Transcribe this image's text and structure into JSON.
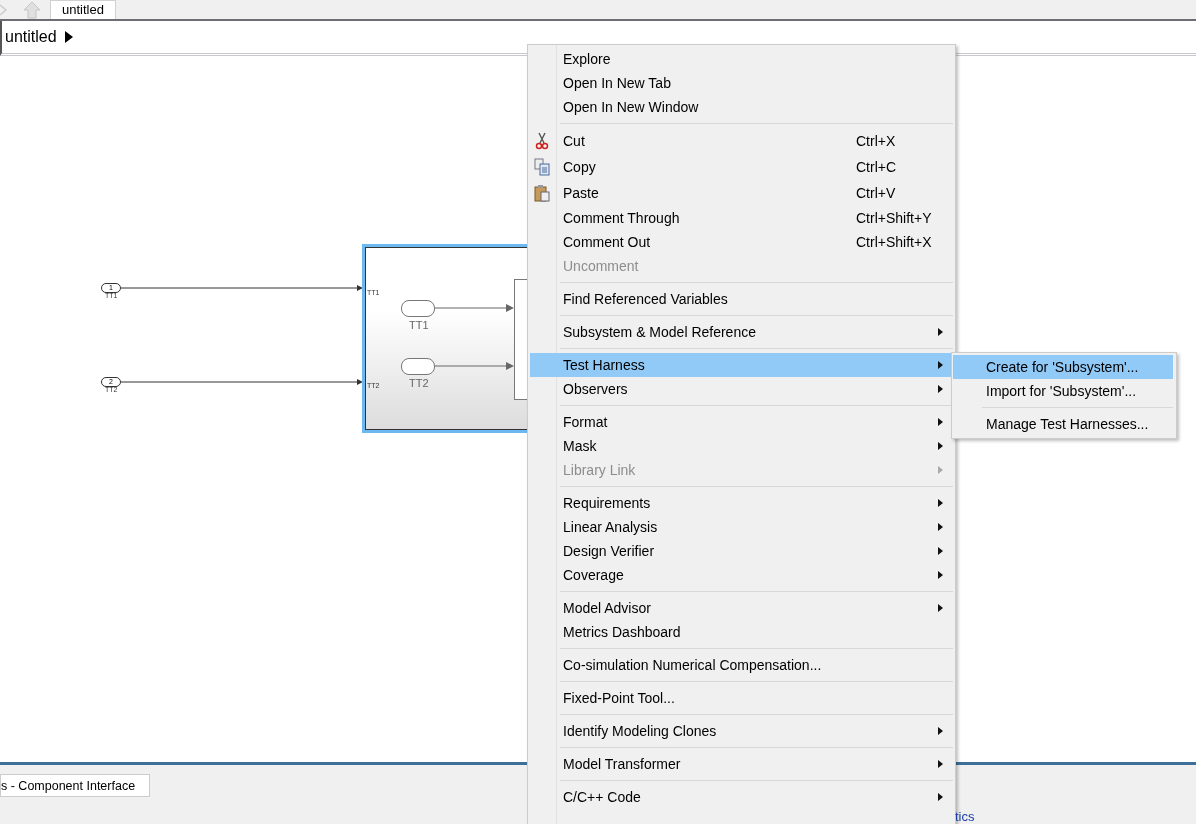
{
  "tabs": [
    {
      "label": "untitled",
      "selected": true
    }
  ],
  "breadcrumb": {
    "label": "untitled"
  },
  "diagram": {
    "inports": [
      {
        "number": "1",
        "label": "TT1"
      },
      {
        "number": "2",
        "label": "TT2"
      }
    ],
    "subsystem": {
      "selected": true,
      "ports": [
        "TT1",
        "TT2"
      ],
      "inner_blocks": [
        "TT1",
        "TT2"
      ]
    }
  },
  "context_menu": {
    "groups": [
      [
        {
          "label": "Explore",
          "submenu": false,
          "disabled": false,
          "selected": false
        },
        {
          "label": "Open In New Tab",
          "submenu": false,
          "disabled": false,
          "selected": false
        },
        {
          "label": "Open In New Window",
          "submenu": false,
          "disabled": false,
          "selected": false
        }
      ],
      [
        {
          "label": "Cut",
          "shortcut": "Ctrl+X",
          "submenu": false,
          "disabled": false,
          "selected": false
        },
        {
          "label": "Copy",
          "shortcut": "Ctrl+C",
          "submenu": false,
          "disabled": false,
          "selected": false
        },
        {
          "label": "Paste",
          "shortcut": "Ctrl+V",
          "submenu": false,
          "disabled": false,
          "selected": false
        },
        {
          "label": "Comment Through",
          "shortcut": "Ctrl+Shift+Y",
          "submenu": false,
          "disabled": false,
          "selected": false
        },
        {
          "label": "Comment Out",
          "shortcut": "Ctrl+Shift+X",
          "submenu": false,
          "disabled": false,
          "selected": false
        },
        {
          "label": "Uncomment",
          "submenu": false,
          "disabled": true,
          "selected": false
        }
      ],
      [
        {
          "label": "Find Referenced Variables",
          "submenu": false,
          "disabled": false,
          "selected": false
        }
      ],
      [
        {
          "label": "Subsystem & Model Reference",
          "submenu": true,
          "disabled": false,
          "selected": false
        }
      ],
      [
        {
          "label": "Test Harness",
          "submenu": true,
          "disabled": false,
          "selected": true
        },
        {
          "label": "Observers",
          "submenu": true,
          "disabled": false,
          "selected": false
        }
      ],
      [
        {
          "label": "Format",
          "submenu": true,
          "disabled": false,
          "selected": false
        },
        {
          "label": "Mask",
          "submenu": true,
          "disabled": false,
          "selected": false
        },
        {
          "label": "Library Link",
          "submenu": true,
          "disabled": true,
          "selected": false
        }
      ],
      [
        {
          "label": "Requirements",
          "submenu": true,
          "disabled": false,
          "selected": false
        },
        {
          "label": "Linear Analysis",
          "submenu": true,
          "disabled": false,
          "selected": false
        },
        {
          "label": "Design Verifier",
          "submenu": true,
          "disabled": false,
          "selected": false
        },
        {
          "label": "Coverage",
          "submenu": true,
          "disabled": false,
          "selected": false
        }
      ],
      [
        {
          "label": "Model Advisor",
          "submenu": true,
          "disabled": false,
          "selected": false
        },
        {
          "label": "Metrics Dashboard",
          "submenu": false,
          "disabled": false,
          "selected": false
        }
      ],
      [
        {
          "label": "Co-simulation Numerical Compensation...",
          "submenu": false,
          "disabled": false,
          "selected": false
        }
      ],
      [
        {
          "label": "Fixed-Point Tool...",
          "submenu": false,
          "disabled": false,
          "selected": false
        }
      ],
      [
        {
          "label": "Identify Modeling Clones",
          "submenu": true,
          "disabled": false,
          "selected": false
        }
      ],
      [
        {
          "label": "Model Transformer",
          "submenu": true,
          "disabled": false,
          "selected": false
        }
      ],
      [
        {
          "label": "C/C++ Code",
          "submenu": true,
          "disabled": false,
          "selected": false
        }
      ]
    ]
  },
  "submenu": {
    "groups": [
      [
        {
          "label": "Create for 'Subsystem'...",
          "selected": true
        },
        {
          "label": "Import for 'Subsystem'...",
          "selected": false
        }
      ],
      [
        {
          "label": "Manage Test Harnesses...",
          "selected": false
        }
      ]
    ]
  },
  "bottom_tabs": [
    {
      "label": "s - Component Interface"
    }
  ],
  "footer_link": "tics"
}
